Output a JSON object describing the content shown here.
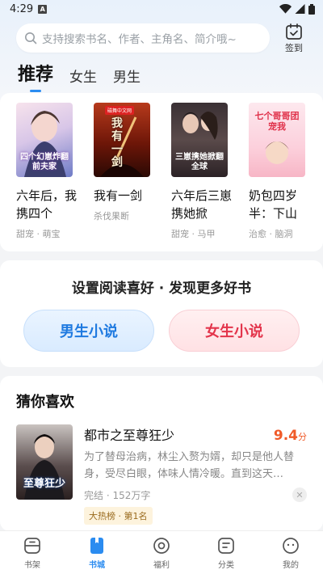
{
  "status": {
    "time": "4:29",
    "notif_glyph": "A"
  },
  "search": {
    "placeholder": "支持搜索书名、作者、主角名、简介哦~"
  },
  "checkin": {
    "label": "签到"
  },
  "tabs": [
    {
      "label": "推荐",
      "active": true
    },
    {
      "label": "女生",
      "active": false
    },
    {
      "label": "男生",
      "active": false
    }
  ],
  "recommend": [
    {
      "title": "六年后，我携四个",
      "tag": "甜宠 · 萌宝",
      "cover_text": "四个幻崽炸翻前夫家"
    },
    {
      "title": "我有一剑",
      "tag": "杀伐果断",
      "cover_text": "我有一剑",
      "cover_badge": "磁舞中文网"
    },
    {
      "title": "六年后三崽携她掀",
      "tag": "甜宠 · 马甲",
      "cover_text": "三崽携她掀翻全球"
    },
    {
      "title": "奶包四岁半：下山",
      "tag": "治愈 · 脑洞",
      "cover_text": "七个哥哥团宠我"
    }
  ],
  "preference": {
    "title": "设置阅读喜好 · 发现更多好书",
    "male_label": "男生小说",
    "female_label": "女生小说"
  },
  "guess": {
    "title": "猜你喜欢",
    "item": {
      "name": "都市之至尊狂少",
      "score": "9.4",
      "score_unit": "分",
      "desc": "为了替母治病，林尘入赘为婿，却只是他人替身，受尽白眼，体味人情冷暖。直到这天…",
      "meta": "完结 · 152万字",
      "badge": "大热榜 · 第1名",
      "dismiss": "✕",
      "cover_text": "至尊狂少"
    }
  },
  "nav": [
    {
      "label": "书架",
      "icon": "bookshelf-icon",
      "active": false
    },
    {
      "label": "书城",
      "icon": "bookstore-icon",
      "active": true
    },
    {
      "label": "福利",
      "icon": "welfare-icon",
      "active": false
    },
    {
      "label": "分类",
      "icon": "category-icon",
      "active": false
    },
    {
      "label": "我的",
      "icon": "profile-icon",
      "active": false
    }
  ],
  "colors": {
    "accent": "#2b8cf0",
    "score": "#f05a28",
    "male": "#1f7ae0",
    "female": "#e3344b"
  }
}
